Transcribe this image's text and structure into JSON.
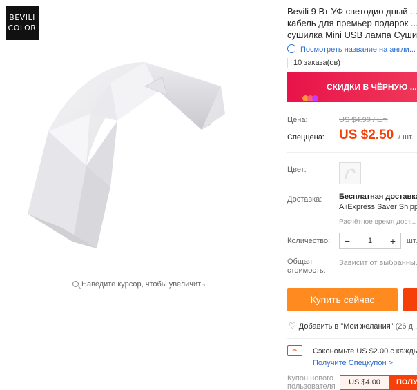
{
  "brand": {
    "line1": "BEVILI",
    "line2": "COLOR"
  },
  "gallery": {
    "zoom_hint": "Наведите курсор, чтобы увеличить"
  },
  "product": {
    "title": "Bevili 9 Вт УФ светодио дный ...",
    "title_line2": "кабель для премьер подарок ...",
    "title_line3": "сушилка Mini USB лампа Суши...",
    "translate_link": "Посмотреть название на англи...",
    "orders": "10 заказа(ов)"
  },
  "sale_banner": {
    "text": "СКИДКИ В ЧЁРНУЮ ...",
    "dot_colors": [
      "#ff9b3a",
      "#ff5b7a",
      "#c23cff"
    ]
  },
  "price": {
    "old_label": "Цена:",
    "old_value": "US $4.99 / шт.",
    "special_label": "Спеццена:",
    "special_value": "US $2.50",
    "per_unit": "/ шт."
  },
  "color": {
    "label": "Цвет:"
  },
  "shipping": {
    "label": "Доставка:",
    "line1": "Бесплатная доставка...",
    "line2": "AliExpress Saver Shipp...",
    "line3": "Расчётное время дост..."
  },
  "quantity": {
    "label": "Количество:",
    "minus": "−",
    "value": "1",
    "plus": "+",
    "unit": "шт."
  },
  "total": {
    "label_1": "Общая",
    "label_2": "стоимость:",
    "value": "Зависит от выбранны..."
  },
  "actions": {
    "buy_now": "Купить сейчас"
  },
  "wishlist": {
    "text": "Добавить в \"Мои желания\"",
    "count": "(26 д..."
  },
  "coupon": {
    "icon_text": "✂",
    "save_text": "Сэкономьте US $2.00 с кажды...",
    "get_link": "Получите Спецкупон >",
    "new_user_label_1": "Купон нового",
    "new_user_label_2": "пользователя",
    "new_user_value": "US $4.00",
    "get_button": "ПОЛУ..."
  },
  "colors": {
    "accent_orange": "#ff8a1f",
    "price_red": "#f5400a",
    "link_blue": "#2f6fcf",
    "banner_red": "#e8134a"
  }
}
